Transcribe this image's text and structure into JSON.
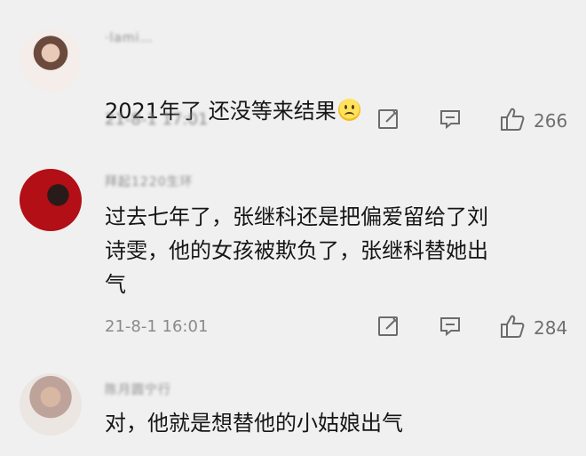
{
  "comments": [
    {
      "username": "·lami…",
      "text": "2021年了 还没等来结果",
      "emoji_icon": "sad-face-icon",
      "time": "21-8-1 17:01",
      "likes": "266"
    },
    {
      "username": "拜起1220生环",
      "text": "过去七年了，张继科还是把偏爱留给了刘\n诗雯，他的女孩被欺负了，张继科替她出\n气",
      "time": "21-8-1 16:01",
      "likes": "284"
    },
    {
      "username": "陈月圆宁行",
      "text": "对，他就是想替他的小姑娘出气"
    }
  ],
  "icons": {
    "edit": "edit-icon",
    "reply": "comment-icon",
    "like": "thumbs-up-icon"
  }
}
